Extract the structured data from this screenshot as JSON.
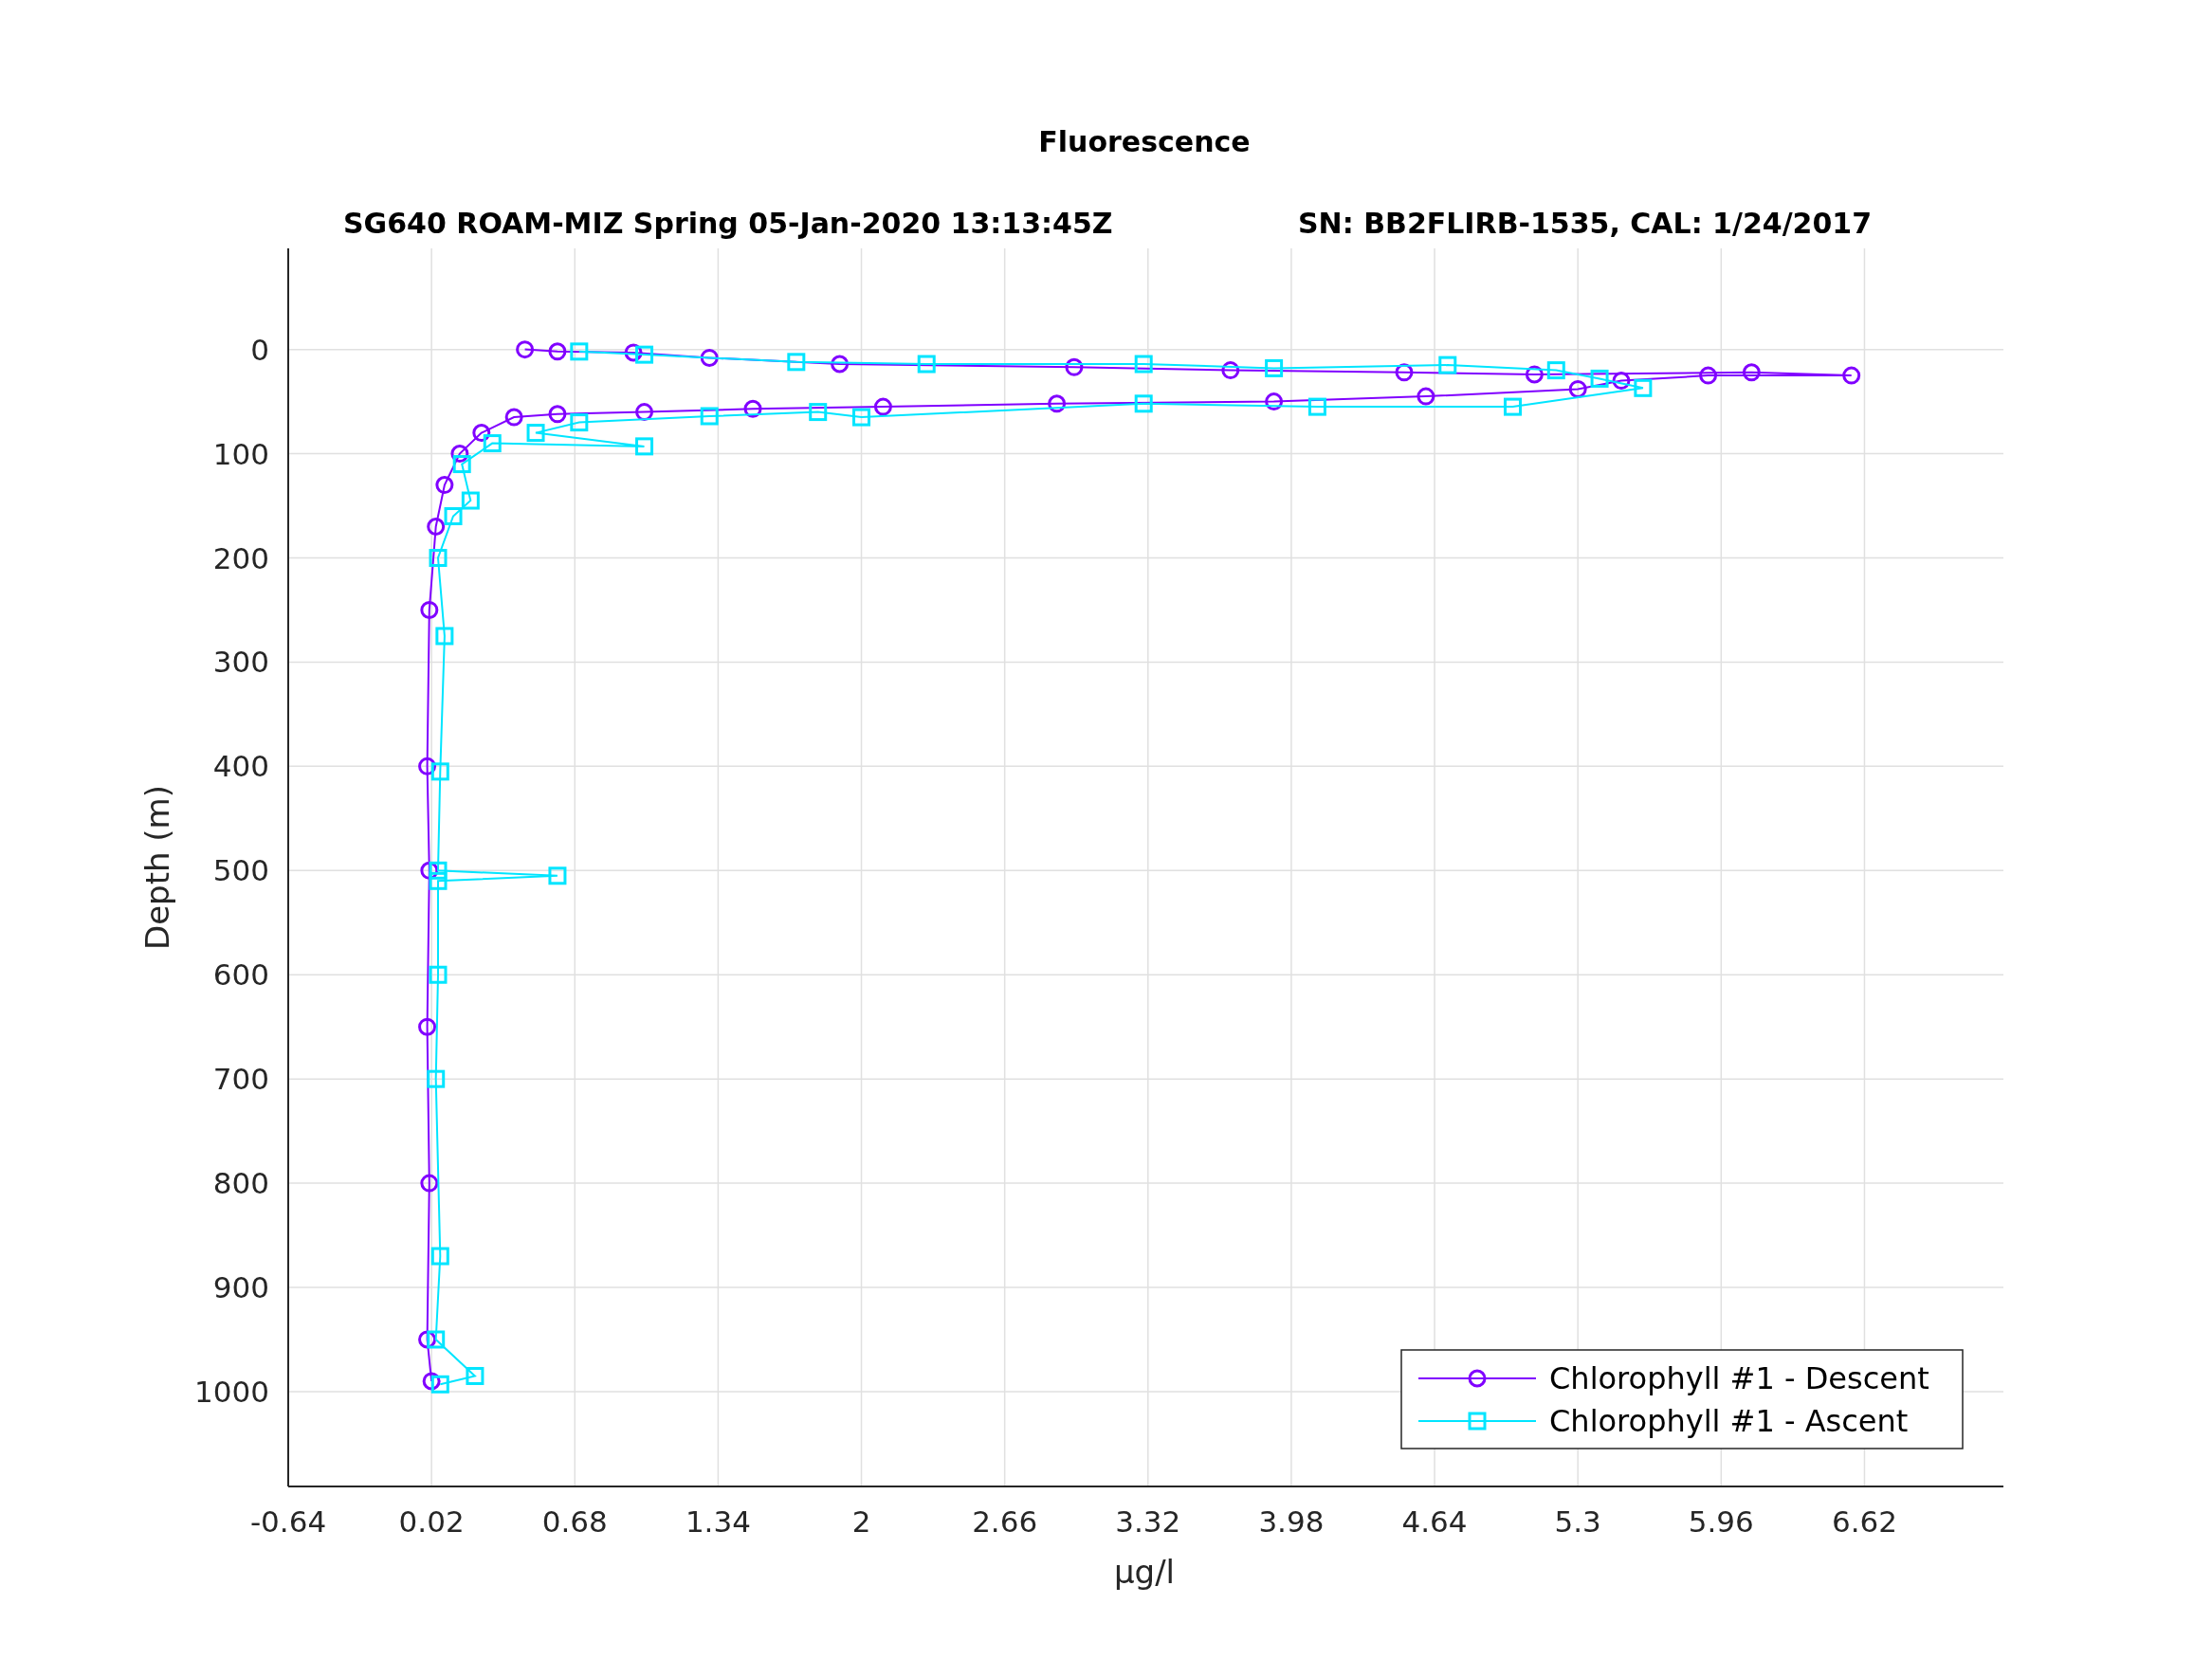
{
  "figure": {
    "title": "Fluorescence",
    "subtitle_left": "SG640 ROAM-MIZ Spring 05-Jan-2020 13:13:45Z",
    "subtitle_right": "SN: BB2FLIRB-1535, CAL: 1/24/2017",
    "chart_data": {
      "type": "line",
      "grid": true,
      "legend": true,
      "xlabel": "μg/l",
      "ylabel": "Depth (m)",
      "xlim": [
        -0.64,
        7.26
      ],
      "ylim": [
        1091,
        -97
      ],
      "xticks": [
        {
          "value": -0.64,
          "label": "-0.64"
        },
        {
          "value": 0.02,
          "label": "0.02"
        },
        {
          "value": 0.68,
          "label": "0.68"
        },
        {
          "value": 1.34,
          "label": "1.34"
        },
        {
          "value": 2,
          "label": "2"
        },
        {
          "value": 2.66,
          "label": "2.66"
        },
        {
          "value": 3.32,
          "label": "3.32"
        },
        {
          "value": 3.98,
          "label": "3.98"
        },
        {
          "value": 4.64,
          "label": "4.64"
        },
        {
          "value": 5.3,
          "label": "5.3"
        },
        {
          "value": 5.96,
          "label": "5.96"
        },
        {
          "value": 6.62,
          "label": "6.62"
        }
      ],
      "yticks": [
        0,
        100,
        200,
        300,
        400,
        500,
        600,
        700,
        800,
        900,
        1000
      ],
      "series": [
        {
          "name": "Chlorophyll #1 - Descent",
          "color": "#8000ff",
          "marker": "circle",
          "x": [
            0.45,
            0.6,
            0.95,
            1.3,
            1.9,
            2.98,
            3.7,
            4.5,
            5.1,
            6.1,
            6.56,
            5.9,
            5.5,
            5.3,
            4.6,
            3.9,
            2.9,
            2.1,
            1.5,
            1.0,
            0.6,
            0.4,
            0.25,
            0.15,
            0.08,
            0.04,
            0.01,
            0.0,
            0.01,
            0.0,
            0.01,
            0.0,
            0.02
          ],
          "values": [
            0,
            2,
            3,
            8,
            14,
            17,
            20,
            22,
            24,
            22,
            25,
            25,
            30,
            38,
            45,
            50,
            52,
            55,
            57,
            60,
            62,
            65,
            80,
            100,
            130,
            170,
            250,
            400,
            500,
            650,
            800,
            950,
            990
          ]
        },
        {
          "name": "Chlorophyll #1 - Ascent",
          "color": "#00e5ff",
          "marker": "square",
          "x": [
            0.06,
            0.22,
            0.04,
            0.06,
            0.04,
            0.05,
            0.05,
            0.6,
            0.05,
            0.06,
            0.08,
            0.05,
            0.12,
            0.2,
            0.16,
            0.3,
            1.0,
            0.5,
            0.7,
            1.3,
            1.8,
            2.0,
            3.3,
            4.1,
            5.0,
            5.6,
            5.4,
            5.2,
            4.7,
            3.9,
            3.3,
            2.3,
            1.7,
            1.0,
            0.7
          ],
          "values": [
            993,
            985,
            950,
            870,
            700,
            600,
            510,
            505,
            500,
            405,
            275,
            200,
            160,
            145,
            110,
            90,
            93,
            80,
            70,
            64,
            60,
            65,
            52,
            55,
            55,
            37,
            28,
            20,
            15,
            18,
            14,
            14,
            12,
            5,
            2
          ]
        }
      ]
    }
  }
}
